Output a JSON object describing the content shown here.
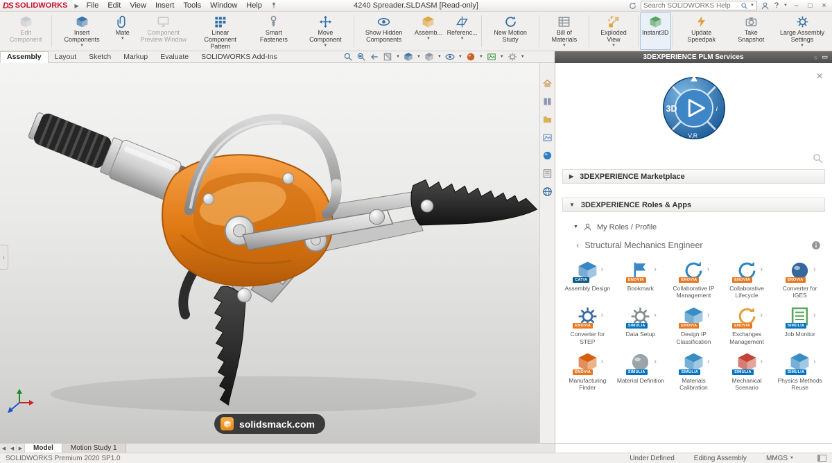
{
  "menubar": {
    "brand": "SOLIDWORKS",
    "menus": [
      "File",
      "Edit",
      "View",
      "Insert",
      "Tools",
      "Window",
      "Help"
    ],
    "doc_title": "4240 Spreader.SLDASM [Read-only]",
    "search_placeholder": "Search SOLIDWORKS Help",
    "help_label": "?"
  },
  "ribbon": {
    "buttons": [
      {
        "label": "Edit Component",
        "disabled": true
      },
      {
        "label": "Insert Components",
        "dropdown": true
      },
      {
        "label": "Mate",
        "dropdown": true
      },
      {
        "label": "Component Preview Window",
        "disabled": true
      },
      {
        "label": "Linear Component Pattern",
        "dropdown": true
      },
      {
        "label": "Smart Fasteners"
      },
      {
        "label": "Move Component",
        "dropdown": true
      },
      {
        "label": "Show Hidden Components"
      },
      {
        "label": "Assemb...",
        "dropdown": true
      },
      {
        "label": "Referenc...",
        "dropdown": true
      },
      {
        "label": "New Motion Study"
      },
      {
        "label": "Bill of Materials",
        "dropdown": true
      },
      {
        "label": "Exploded View",
        "dropdown": true
      },
      {
        "label": "Instant3D",
        "active": true
      },
      {
        "label": "Update Speedpak"
      },
      {
        "label": "Take Snapshot"
      },
      {
        "label": "Large Assembly Settings",
        "dropdown": true
      }
    ]
  },
  "cmd_tabs": {
    "tabs": [
      "Assembly",
      "Layout",
      "Sketch",
      "Markup",
      "Evaluate",
      "SOLIDWORKS Add-Ins"
    ],
    "active": "Assembly"
  },
  "viewport": {
    "watermark": "solidsmack.com",
    "hud_icons": [
      "zoom-fit",
      "zoom-area",
      "previous-view",
      "section-view",
      "view-orientation",
      "display-style",
      "hide-show-items",
      "edit-appearance",
      "apply-scene",
      "view-settings"
    ]
  },
  "taskpane": {
    "title": "3DEXPERIENCE PLM Services",
    "tab_icons": [
      "home",
      "solidworks-resources",
      "file-explorer",
      "view-palette",
      "appearances",
      "custom-properties",
      "plm-services"
    ],
    "compass": {
      "left": "3D",
      "bottom": "V,R",
      "right": "i"
    },
    "sections": [
      {
        "label": "3DEXPERIENCE Marketplace",
        "expanded": false
      },
      {
        "label": "3DEXPERIENCE Roles & Apps",
        "expanded": true
      }
    ],
    "roles_header": "My Roles / Profile",
    "role_name": "Structural Mechanics Engineer",
    "apps": [
      {
        "name": "Assembly Design",
        "brand": "CATIA",
        "brand_color": "#0b5a8e",
        "icon_color": "#2f7fc1"
      },
      {
        "name": "Bookmark",
        "brand": "ENOVIA",
        "brand_color": "#e87722",
        "icon_color": "#3a86c8"
      },
      {
        "name": "Collaborative IP Management",
        "brand": "ENOVIA",
        "brand_color": "#e87722",
        "icon_color": "#2e86c1"
      },
      {
        "name": "Collaborative Lifecycle",
        "brand": "ENOVIA",
        "brand_color": "#e87722",
        "icon_color": "#2e86c1"
      },
      {
        "name": "Converter for IGES",
        "brand": "ENOVIA",
        "brand_color": "#e87722",
        "icon_color": "#34689f"
      },
      {
        "name": "Converter for STEP",
        "brand": "ENOVIA",
        "brand_color": "#e87722",
        "icon_color": "#34689f"
      },
      {
        "name": "Data Setup",
        "brand": "SIMULIA",
        "brand_color": "#0073c2",
        "icon_color": "#7f8c8d"
      },
      {
        "name": "Design IP Classification",
        "brand": "ENOVIA",
        "brand_color": "#e87722",
        "icon_color": "#2e86c1"
      },
      {
        "name": "Exchanges Management",
        "brand": "ENOVIA",
        "brand_color": "#e87722",
        "icon_color": "#e0a23a"
      },
      {
        "name": "Job Monitor",
        "brand": "SIMULIA",
        "brand_color": "#0073c2",
        "icon_color": "#58a65c"
      },
      {
        "name": "Manufacturing Finder",
        "brand": "ENOVIA",
        "brand_color": "#e87722",
        "icon_color": "#d35400"
      },
      {
        "name": "Material Definition",
        "brand": "SIMULIA",
        "brand_color": "#0073c2",
        "icon_color": "#9aa3a8"
      },
      {
        "name": "Materials Calibration",
        "brand": "SIMULIA",
        "brand_color": "#0073c2",
        "icon_color": "#2e86c1"
      },
      {
        "name": "Mechanical Scenario",
        "brand": "SIMULIA",
        "brand_color": "#0073c2",
        "icon_color": "#c0392b"
      },
      {
        "name": "Physics Methods Reuse",
        "brand": "SIMULIA",
        "brand_color": "#0073c2",
        "icon_color": "#2e86c1"
      }
    ]
  },
  "bottom_tabs": {
    "tabs": [
      "Model",
      "Motion Study 1"
    ],
    "active": "Model"
  },
  "statusbar": {
    "product": "SOLIDWORKS Premium 2020 SP1.0",
    "state": "Under Defined",
    "mode": "Editing Assembly",
    "units": "MMGS"
  }
}
